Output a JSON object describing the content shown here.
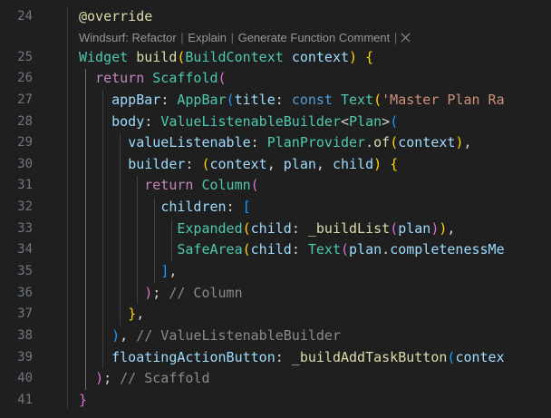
{
  "editor": {
    "line_numbers": [
      "24",
      "25",
      "26",
      "27",
      "28",
      "29",
      "30",
      "31",
      "32",
      "33",
      "34",
      "35",
      "36",
      "37",
      "38",
      "39",
      "40",
      "41"
    ],
    "codelens": {
      "prefix": "Windsurf: Refactor",
      "explain": "Explain",
      "generate": "Generate Function Comment",
      "separator": "|"
    },
    "lines": {
      "l24": {
        "annotation": "@override"
      },
      "l25": {
        "type": "Widget",
        "fn": "build",
        "open": "(",
        "ptype": "BuildContext",
        "param": "context",
        "close": ")",
        "brace": "{"
      },
      "l26": {
        "kw": "return",
        "cls": "Scaffold",
        "open": "("
      },
      "l27": {
        "prop": "appBar",
        "colon": ":",
        "cls": "AppBar",
        "open": "(",
        "prop2": "title",
        "colon2": ":",
        "kw": "const",
        "cls2": "Text",
        "open2": "(",
        "str": "'Master Plan Ra"
      },
      "l28": {
        "prop": "body",
        "colon": ":",
        "cls": "ValueListenableBuilder",
        "lt": "<",
        "generic": "Plan",
        "gt": ">",
        "open": "("
      },
      "l29": {
        "prop": "valueListenable",
        "colon": ":",
        "cls": "PlanProvider",
        "dot": ".",
        "fn": "of",
        "open": "(",
        "arg": "context",
        "close": ")",
        "comma": ","
      },
      "l30": {
        "prop": "builder",
        "colon": ":",
        "open": "(",
        "a1": "context",
        "c1": ",",
        "a2": "plan",
        "c2": ",",
        "a3": "child",
        "close": ")",
        "brace": "{"
      },
      "l31": {
        "kw": "return",
        "cls": "Column",
        "open": "("
      },
      "l32": {
        "prop": "children",
        "colon": ":",
        "open": "["
      },
      "l33": {
        "cls": "Expanded",
        "open": "(",
        "prop": "child",
        "colon": ":",
        "fn": "_buildList",
        "open2": "(",
        "arg": "plan",
        "close2": ")",
        "close": ")",
        "comma": ","
      },
      "l34": {
        "cls": "SafeArea",
        "open": "(",
        "prop": "child",
        "colon": ":",
        "cls2": "Text",
        "open2": "(",
        "arg": "plan",
        "dot": ".",
        "member": "completenessMe"
      },
      "l35": {
        "close": "]",
        "comma": ","
      },
      "l36": {
        "close": ")",
        "semi": ";",
        "comment": "// Column"
      },
      "l37": {
        "close": "}",
        "comma": ","
      },
      "l38": {
        "close": ")",
        "comma": ",",
        "comment": "// ValueListenableBuilder"
      },
      "l39": {
        "prop": "floatingActionButton",
        "colon": ":",
        "fn": "_buildAddTaskButton",
        "open": "(",
        "arg": "contex"
      },
      "l40": {
        "close": ")",
        "semi": ";",
        "comment": "// Scaffold"
      },
      "l41": {
        "close": "}"
      }
    }
  }
}
